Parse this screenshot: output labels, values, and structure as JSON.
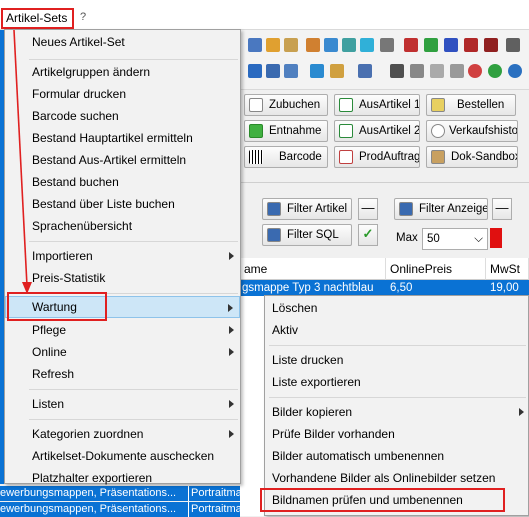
{
  "menubar": {
    "active_menu": "Artikel-Sets",
    "help": "?"
  },
  "toolbar_buttons": {
    "zubuchen": "Zubuchen",
    "ausartikel1": "AusArtikel 1",
    "bestellen": "Bestellen",
    "entnahme": "Entnahme",
    "ausartikel2": "AusArtikel 2",
    "verkaufshistorie": "Verkaufshistorie",
    "barcode": "Barcode",
    "prodauftrag": "ProdAuftrag",
    "doksandbox": "Dok-Sandbox"
  },
  "filters": {
    "filter_artikel": "Filter Artikel",
    "filter_anzeige": "Filter Anzeige",
    "filter_sql": "Filter SQL",
    "minus": "—",
    "check": "✓",
    "max_label": "Max",
    "max_value": "50",
    "dropdown": "⌵"
  },
  "grid": {
    "columns": {
      "name_partial": "ame",
      "onlinepreis": "OnlinePreis",
      "mwst": "MwSt"
    },
    "selected_row": {
      "name": "gsmappe Typ 3 nachtblau",
      "price": "6,50",
      "mwst": "19,00"
    },
    "left_rows": [
      {
        "text": "ewerbungsmappen, Präsentations...",
        "col2": "Portraitma"
      },
      {
        "text": "ewerbungsmappen, Präsentations...",
        "col2": "Portraitma"
      }
    ]
  },
  "main_menu": {
    "items": [
      "Neues Artikel-Set",
      "Artikelgruppen ändern",
      "Formular drucken",
      "Barcode suchen",
      "Bestand Hauptartikel ermitteln",
      "Bestand Aus-Artikel ermitteln",
      "Bestand buchen",
      "Bestand über Liste buchen",
      "Sprachenübersicht",
      "Importieren",
      "Preis-Statistik",
      "Wartung",
      "Pflege",
      "Online",
      "Refresh",
      "Listen",
      "Kategorien zuordnen",
      "Artikelset-Dokumente auschecken",
      "Platzhalter exportieren"
    ],
    "highlighted": "Wartung"
  },
  "submenu_wartung": {
    "items": [
      "Löschen",
      "Aktiv",
      "Liste drucken",
      "Liste exportieren",
      "Bilder kopieren",
      "Prüfe Bilder vorhanden",
      "Bilder automatisch umbenennen",
      "Vorhandene Bilder als Onlinebilder setzen",
      "Bildnamen prüfen und umbenennen"
    ],
    "annotated": "Bildnamen prüfen und umbenennen"
  },
  "colors": {
    "selection_blue": "#0a72d4",
    "annotation_red": "#e02020",
    "menu_highlight": "#cde6f7"
  }
}
